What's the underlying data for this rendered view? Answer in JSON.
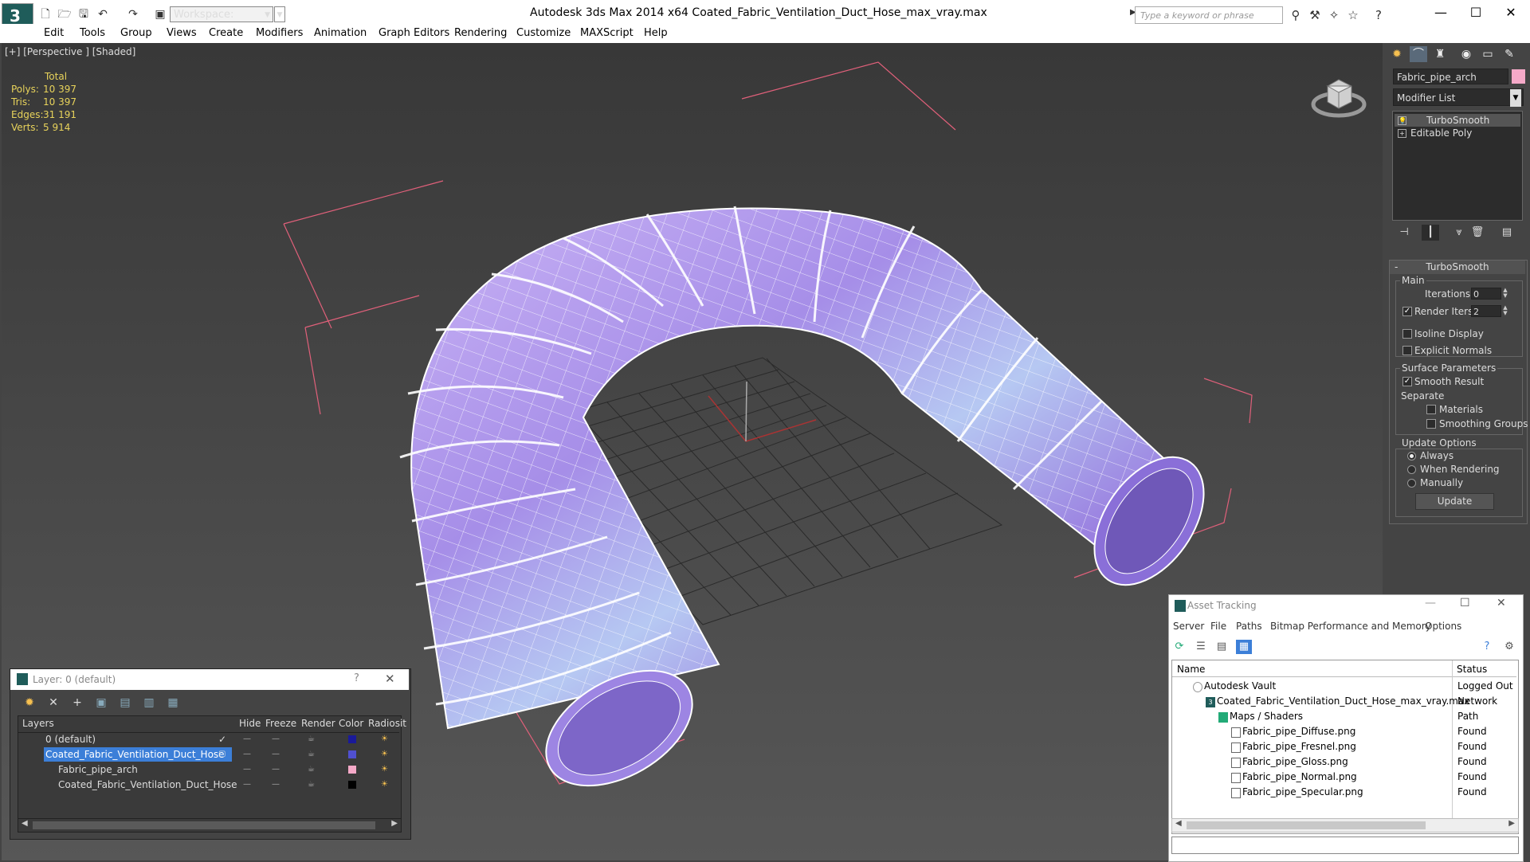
{
  "titlebar": {
    "workspace_label": "Workspace: Default",
    "app_title": "Autodesk 3ds Max  2014 x64     Coated_Fabric_Ventilation_Duct_Hose_max_vray.max",
    "search_placeholder": "Type a keyword or phrase",
    "minimize": "—",
    "maximize": "☐",
    "close": "✕"
  },
  "menu": [
    "Edit",
    "Tools",
    "Group",
    "Views",
    "Create",
    "Modifiers",
    "Animation",
    "Graph Editors",
    "Rendering",
    "Customize",
    "MAXScript",
    "Help"
  ],
  "viewport": {
    "label": "[+] [Perspective ] [Shaded]",
    "stats_header": "Total",
    "stats": [
      {
        "label": "Polys:",
        "value": "10 397"
      },
      {
        "label": "Tris:",
        "value": "10 397"
      },
      {
        "label": "Edges:",
        "value": "31 191"
      },
      {
        "label": "Verts:",
        "value": "5 914"
      }
    ]
  },
  "command_panel": {
    "object_name": "Fabric_pipe_arch",
    "object_color": "#f5a9c8",
    "modifier_list": "Modifier List",
    "stack": [
      "TurboSmooth",
      "Editable Poly"
    ],
    "rollout_title": "TurboSmooth",
    "main_label": "Main",
    "iterations_label": "Iterations:",
    "iterations_value": "0",
    "render_iters_label": "Render Iters:",
    "render_iters_value": "2",
    "isoline_label": "Isoline Display",
    "explicit_normals_label": "Explicit Normals",
    "surface_params_label": "Surface Parameters",
    "smooth_result_label": "Smooth Result",
    "separate_label": "Separate",
    "materials_label": "Materials",
    "smoothing_groups_label": "Smoothing Groups",
    "update_options_label": "Update Options",
    "always_label": "Always",
    "when_rendering_label": "When Rendering",
    "manually_label": "Manually",
    "update_button": "Update"
  },
  "layer_dialog": {
    "title": "Layer: 0 (default)",
    "help": "?",
    "close": "✕",
    "columns": [
      "Layers",
      "Hide",
      "Freeze",
      "Render",
      "Color",
      "Radiosit"
    ],
    "rows": [
      {
        "name": "0 (default)",
        "color": "#1a1a9a",
        "selected": false,
        "indent": 0
      },
      {
        "name": "Coated_Fabric_Ventilation_Duct_Hose",
        "color": "#5050d0",
        "selected": true,
        "indent": 0
      },
      {
        "name": "Fabric_pipe_arch",
        "color": "#f5a9c8",
        "selected": false,
        "indent": 1
      },
      {
        "name": "Coated_Fabric_Ventilation_Duct_Hose",
        "color": "#000000",
        "selected": false,
        "indent": 1
      }
    ]
  },
  "asset_tracking": {
    "title": "Asset Tracking",
    "menu": [
      "Server",
      "File",
      "Paths",
      "Bitmap Performance and Memory",
      "Options"
    ],
    "columns": [
      "Name",
      "Status"
    ],
    "rows": [
      {
        "name": "Autodesk Vault",
        "status": "Logged Out ...",
        "indent": 0
      },
      {
        "name": "Coated_Fabric_Ventilation_Duct_Hose_max_vray.max",
        "status": "Network Path",
        "indent": 1
      },
      {
        "name": "Maps / Shaders",
        "status": "",
        "indent": 2
      },
      {
        "name": "Fabric_pipe_Diffuse.png",
        "status": "Found",
        "indent": 3
      },
      {
        "name": "Fabric_pipe_Fresnel.png",
        "status": "Found",
        "indent": 3
      },
      {
        "name": "Fabric_pipe_Gloss.png",
        "status": "Found",
        "indent": 3
      },
      {
        "name": "Fabric_pipe_Normal.png",
        "status": "Found",
        "indent": 3
      },
      {
        "name": "Fabric_pipe_Specular.png",
        "status": "Found",
        "indent": 3
      }
    ]
  }
}
